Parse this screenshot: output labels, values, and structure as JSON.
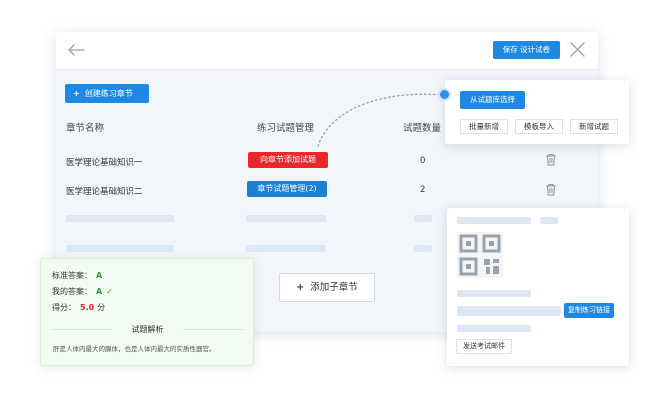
{
  "header": {
    "save_label": "保存 设计试卷"
  },
  "toolbar": {
    "create_chapter_label": "创建练习章节"
  },
  "table": {
    "columns": [
      "章节名称",
      "练习试题管理",
      "试题数量"
    ],
    "rows": [
      {
        "name": "医学理论基础知识一",
        "action": "向章节添加试题",
        "count": "0"
      },
      {
        "name": "医学理论基础知识二",
        "action": "章节试题管理(2)",
        "count": "2"
      }
    ]
  },
  "add_subchapter_label": "添加子章节",
  "library_popover": {
    "select_label": "从试题库选择",
    "options": [
      "批量新增",
      "模板导入",
      "新增试题"
    ]
  },
  "share_panel": {
    "copy_link_label": "复制练习链接",
    "send_mail_label": "发送考试邮件"
  },
  "answer_panel": {
    "standard_label": "标准答案：",
    "standard_value": "A",
    "mine_label": "我的答案：",
    "mine_value": "A",
    "score_label": "得分：",
    "score_value": "5.0",
    "score_unit": "分",
    "analysis_title": "试题解析",
    "analysis_text": "肝是人体内最大的腺体，也是人体内最大的实质性器官。"
  },
  "colors": {
    "primary": "#1e88e5",
    "danger": "#e8282b",
    "success": "#2e9a3a"
  }
}
